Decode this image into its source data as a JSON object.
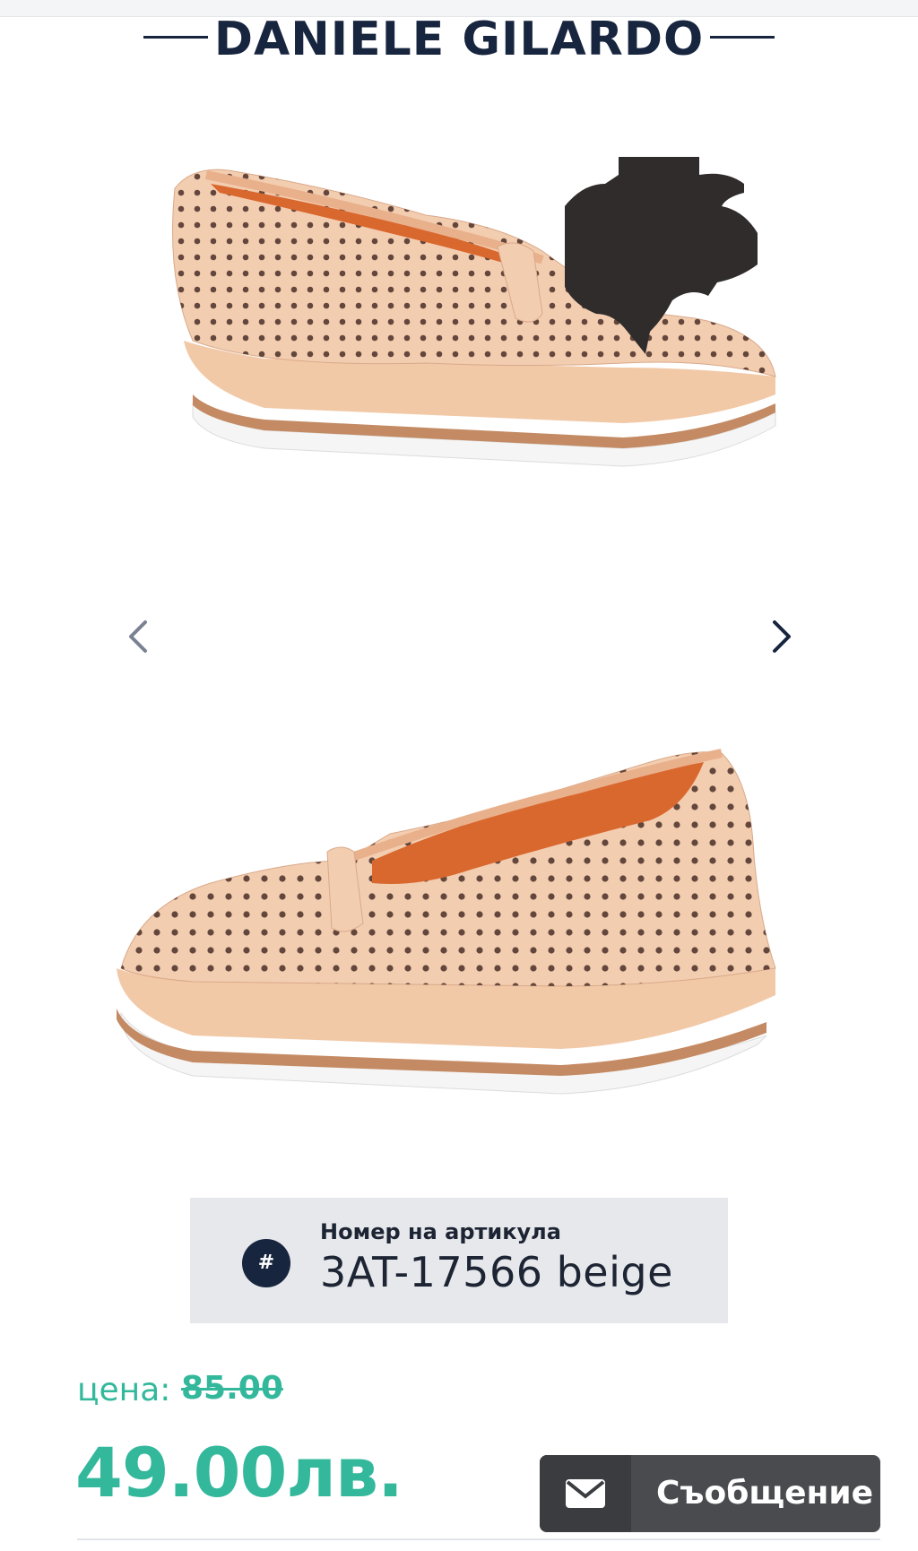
{
  "brand": {
    "name": "DANIELE GILARDO"
  },
  "gallery": {
    "prev_icon": "chevron-left-icon",
    "next_icon": "chevron-right-icon",
    "badge_icon": "genuine-leather-icon"
  },
  "sku": {
    "label": "Номер на артикула",
    "value": "3AT-17566 beige",
    "icon_text": "#"
  },
  "price": {
    "label": "цена:",
    "old": "85.00",
    "current": "49.00лв."
  },
  "message_button": {
    "label": "Съобщение",
    "icon": "envelope-icon"
  },
  "colors": {
    "brand_navy": "#17253f",
    "accent_green": "#33b89c",
    "button_gray": "#4a4b4f"
  }
}
